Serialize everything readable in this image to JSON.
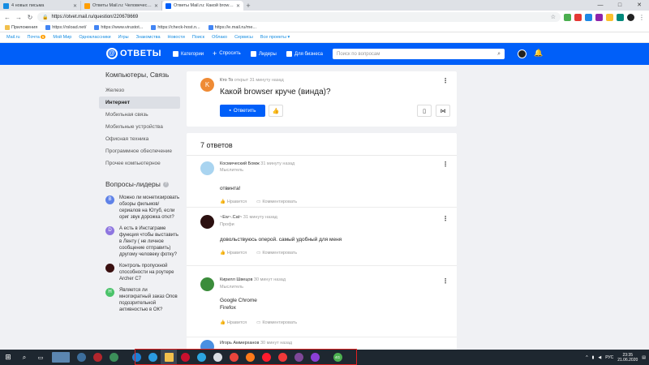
{
  "browser": {
    "tabs": [
      {
        "label": "4 новых письма",
        "color": "#168de2",
        "active": false
      },
      {
        "label": "Ответы Mail.ru: Человеческий",
        "color": "#ff9e00",
        "active": false
      },
      {
        "label": "Ответы Mail.ru: Какой browser к",
        "color": "#005ff9",
        "active": true
      }
    ],
    "new_tab_icon": "+",
    "window_controls": [
      "—",
      "□",
      "✕"
    ],
    "url": "https://otvet.mail.ru/question/220678669",
    "bookmarks": [
      {
        "label": "Приложения",
        "folder": false
      },
      {
        "label": "https://rsload.net/",
        "folder": false
      },
      {
        "label": "https://www.virustot...",
        "folder": false
      },
      {
        "label": "https://check-host.n...",
        "folder": false
      },
      {
        "label": "https://e.mail.ru/me...",
        "folder": false
      }
    ]
  },
  "portal": {
    "items": [
      "Mail.ru",
      "Почта",
      "Мой Мир",
      "Одноклассники",
      "Игры",
      "Знакомства",
      "Новости",
      "Поиск",
      "Облако",
      "Сервисы",
      "Все проекты ▾"
    ],
    "mail_badge": "6"
  },
  "header": {
    "logo": "ОТВЕТЫ",
    "nav": {
      "categories": "Категории",
      "ask": "Спросить",
      "leaders": "Лидеры",
      "business": "Для бизнеса"
    },
    "search_placeholder": "Поиск по вопросам"
  },
  "sidebar": {
    "title": "Компьютеры, Связь",
    "items": [
      {
        "label": "Железо",
        "active": false
      },
      {
        "label": "Интернет",
        "active": true
      },
      {
        "label": "Мобильная связь",
        "active": false
      },
      {
        "label": "Мобильные устройства",
        "active": false
      },
      {
        "label": "Офисная техника",
        "active": false
      },
      {
        "label": "Программное обеспечение",
        "active": false
      },
      {
        "label": "Прочее компьютерное",
        "active": false
      }
    ],
    "leaders_title": "Вопросы-лидеры",
    "help_icon": "?",
    "leaders": [
      {
        "text": "Можно ли монетизировать обзоры фильмов/ сериалов на Ютуб, если ориг звук дорожка откл?",
        "letter": "В",
        "color": "#5f82e8"
      },
      {
        "text": "А есть в Инстаграме функция чтобы выставить в Ленту ( не личное сообщение отправить) другому человеку фотку?",
        "letter": "D",
        "color": "#8e76e0"
      },
      {
        "text": "Контроль пропускной способности на роутере Archer C7",
        "letter": "",
        "color": "#3a1010"
      },
      {
        "text": "Является ли многократный заказ Опов подозрительной активностью в ОК?",
        "letter": "Н",
        "color": "#4bc36a"
      }
    ]
  },
  "question": {
    "avatar_letter": "K",
    "author": "Кто То",
    "meta": "открыт 31 минуту назад",
    "title": "Какой browser круче (винда)?",
    "answer_button": "Ответить"
  },
  "answers": {
    "count_label": "7 ответов",
    "like_label": "Нравится",
    "comment_label": "Комментировать",
    "items": [
      {
        "name": "Космический Бомж",
        "time": "31 минуту назад",
        "rank": "Мыслитель",
        "lines": [
          "отвинта!"
        ],
        "avatar_color": "#a9d4f0"
      },
      {
        "name": "~Ew~.Cat~",
        "time": "31 минуту назад",
        "rank": "Профи",
        "lines": [
          "довольствуюсь оперой. самый удобный для меня"
        ],
        "avatar_color": "#2b1010"
      },
      {
        "name": "Кирилл Швецов",
        "time": "30 минут назад",
        "rank": "Мыслитель",
        "lines": [
          "Google Chrome",
          "Firefox"
        ],
        "avatar_color": "#3b8c3b"
      },
      {
        "name": "Игорь Аммерханов",
        "time": "30 минут назад",
        "rank": "",
        "lines": [],
        "avatar_color": "#4a90e2"
      }
    ]
  },
  "taskbar": {
    "apps": [
      {
        "name": "edge-icon",
        "color": "#1e7fd4"
      },
      {
        "name": "ie-icon",
        "color": "#2a9be0"
      },
      {
        "name": "explorer-icon",
        "color": "#f2c04c"
      },
      {
        "name": "opera-gx-icon",
        "color": "#c8102e"
      },
      {
        "name": "telegram-icon",
        "color": "#2ca5e0"
      },
      {
        "name": "browser-icon",
        "color": "#d9dde3"
      },
      {
        "name": "chrome-icon",
        "color": "#e8453c"
      },
      {
        "name": "firefox-icon",
        "color": "#ff7a1a"
      },
      {
        "name": "opera-icon",
        "color": "#ff1b2d"
      },
      {
        "name": "vivaldi-icon",
        "color": "#ef3939"
      },
      {
        "name": "tor-icon",
        "color": "#7e4798"
      },
      {
        "name": "opera-neon-icon",
        "color": "#8b3fd6"
      }
    ],
    "badge_app_label": "4G",
    "language": "РУС",
    "time": "23:35",
    "date": "21.06.2020"
  },
  "colors": {
    "brand_blue": "#005ff9",
    "highlight_red": "#e02020"
  }
}
